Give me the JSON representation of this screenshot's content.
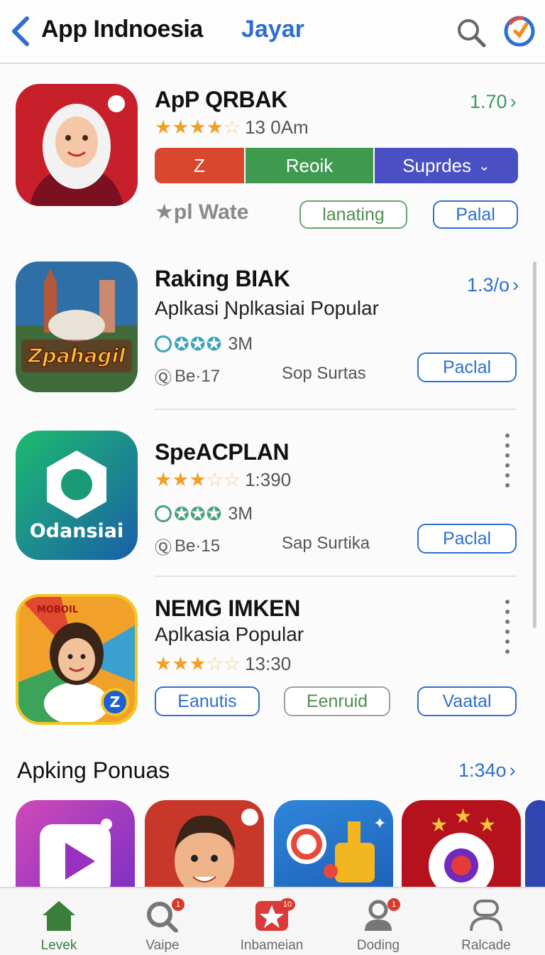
{
  "header": {
    "title": "App Indnoesia",
    "link": "Jayar",
    "icons": [
      "chevron-left-icon",
      "search-icon",
      "profile-icon"
    ]
  },
  "apps": [
    {
      "name": "ApP QRBAK",
      "rating_text": "13 0Am",
      "stars": 4,
      "side_value": "1.70",
      "segments": [
        "Z",
        "Reoik",
        "Suprdes"
      ],
      "segment_colors": [
        "#d9472e",
        "#3f9a50",
        "#4a4fc4"
      ],
      "label": "★pl Wate",
      "pills": [
        "lanating",
        "Palal"
      ]
    },
    {
      "name": "Raking BIAK",
      "subtitle": "Aplkasi  Ɲplkasiai Popular",
      "side_value": "1.3/o",
      "green_rating_text": "3M",
      "meta_left": "Be·17",
      "meta_right": "Sop Surtas",
      "button": "Paclal",
      "icon_text": "Zpahagil"
    },
    {
      "name": "SpeACPLAN",
      "rating_text": "1:390",
      "stars": 3.5,
      "green_rating_text": "3M",
      "meta_left": "Be·15",
      "meta_right": "Sap Surtika",
      "button": "Paclal",
      "icon_text": "Odansiai"
    },
    {
      "name": "NEMG IMKEN",
      "subtitle": "Aplkasia Popular",
      "rating_text": "13:30",
      "stars": 3.5,
      "pills": [
        "Eanutis",
        "Eenruid",
        "Vaatal"
      ],
      "icon_text": "MOBOIL",
      "badge": "Z"
    }
  ],
  "section": {
    "title": "Apking Ponuas",
    "link": "1:34o"
  },
  "tabs": [
    {
      "label": "Levek",
      "icon": "home-icon",
      "active": true
    },
    {
      "label": "Vaipe",
      "icon": "search-icon",
      "badge": "1"
    },
    {
      "label": "Inbameian",
      "icon": "star-icon",
      "badge": "10"
    },
    {
      "label": "Doding",
      "icon": "person-icon",
      "badge": "1"
    },
    {
      "label": "Ralcade",
      "icon": "account-icon"
    }
  ],
  "colors": {
    "accent": "#2f6fd1",
    "green": "#3a9a5a",
    "star": "#f2a023"
  }
}
